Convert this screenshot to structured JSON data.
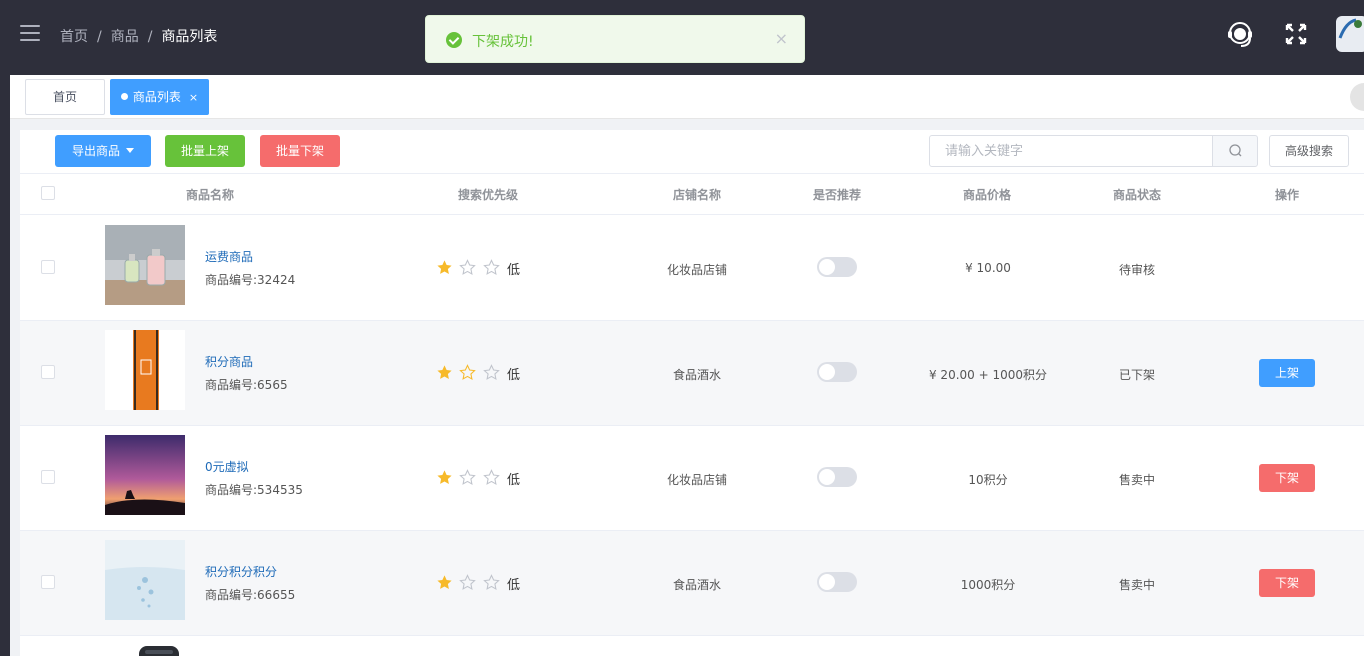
{
  "header": {
    "breadcrumb": [
      "首页",
      "商品",
      "商品列表"
    ],
    "breadcrumb_sep": "/"
  },
  "toast": {
    "message": "下架成功!",
    "close": "×",
    "type": "success",
    "color": "#67c23a"
  },
  "tabs": [
    {
      "label": "首页",
      "active": false
    },
    {
      "label": "商品列表",
      "active": true,
      "close": "×"
    }
  ],
  "toolbar": {
    "export_label": "导出商品",
    "batch_on_label": "批量上架",
    "batch_off_label": "批量下架",
    "search_placeholder": "请输入关键字",
    "search_value": "",
    "advanced_label": "高级搜索"
  },
  "table": {
    "columns": [
      "商品名称",
      "搜索优先级",
      "店铺名称",
      "是否推荐",
      "商品价格",
      "商品状态",
      "操作"
    ],
    "rows": [
      {
        "name": "运费商品",
        "code": "商品编号:32424",
        "rating": 1,
        "level": "低",
        "shop": "化妆品店铺",
        "recommend": false,
        "price": "¥ 10.00",
        "status": "待审核",
        "action": ""
      },
      {
        "name": "积分商品",
        "code": "商品编号:6565",
        "rating": 1,
        "level": "低",
        "shop": "食品酒水",
        "recommend": false,
        "price": "¥ 20.00 + 1000积分",
        "status": "已下架",
        "action": "上架"
      },
      {
        "name": "0元虚拟",
        "code": "商品编号:534535",
        "rating": 1,
        "level": "低",
        "shop": "化妆品店铺",
        "recommend": false,
        "price": "10积分",
        "status": "售卖中",
        "action": "下架"
      },
      {
        "name": "积分积分积分",
        "code": "商品编号:66655",
        "rating": 1,
        "level": "低",
        "shop": "食品酒水",
        "recommend": false,
        "price": "1000积分",
        "status": "售卖中",
        "action": "下架"
      }
    ]
  },
  "colors": {
    "primary": "#409eff",
    "success": "#67c23a",
    "danger": "#f56c6c",
    "topbar": "#2e2f3b",
    "star": "#f7ba2a"
  },
  "icons": [
    "menu-icon",
    "headset-icon",
    "fullscreen-icon",
    "avatar",
    "search-icon",
    "success-icon",
    "star-icon"
  ]
}
